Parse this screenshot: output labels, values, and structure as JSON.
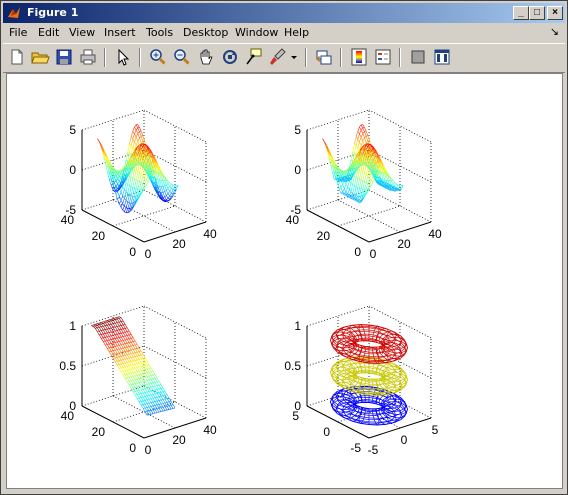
{
  "window": {
    "title": "Figure 1"
  },
  "titlebar_buttons": {
    "minimize": "_",
    "maximize": "□",
    "close": "×"
  },
  "menu": [
    "File",
    "Edit",
    "View",
    "Insert",
    "Tools",
    "Desktop",
    "Window",
    "Help"
  ],
  "menu_overflow": "↘",
  "toolbar_icons": [
    "new-figure-icon",
    "open-file-icon",
    "save-icon",
    "print-icon",
    "edit-plot-arrow-icon",
    "zoom-in-icon",
    "zoom-out-icon",
    "pan-hand-icon",
    "rotate-3d-icon",
    "data-cursor-icon",
    "brush-icon",
    "brush-dropdown-icon",
    "link-plot-icon",
    "colorbar-icon",
    "legend-icon",
    "hide-plot-tools-icon",
    "show-plot-tools-icon"
  ],
  "subplots": [
    {
      "kind": "mesh-surface",
      "z_ticks": [
        "5",
        "0",
        "-5"
      ],
      "x_ticks": [
        "0",
        "20",
        "40"
      ],
      "y_ticks": [
        "40",
        "20",
        "0"
      ]
    },
    {
      "kind": "mesh-surface-flat-edge",
      "z_ticks": [
        "5",
        "0",
        "-5"
      ],
      "x_ticks": [
        "0",
        "20",
        "40"
      ],
      "y_ticks": [
        "40",
        "20",
        "0"
      ]
    },
    {
      "kind": "mesh-plane",
      "z_ticks": [
        "1",
        "0.5",
        "0"
      ],
      "x_ticks": [
        "0",
        "20",
        "40"
      ],
      "y_ticks": [
        "40",
        "20",
        "0"
      ]
    },
    {
      "kind": "stacked-tori",
      "z_ticks": [
        "1",
        "0.5",
        "0"
      ],
      "x_ticks": [
        "-5",
        "0",
        "5"
      ],
      "y_ticks": [
        "5",
        "0",
        "-5"
      ]
    }
  ]
}
